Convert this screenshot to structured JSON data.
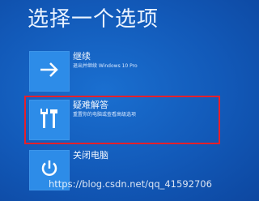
{
  "page": {
    "title": "选择一个选项"
  },
  "options": [
    {
      "title": "继续",
      "description": "退出并继续 Windows 10 Pro",
      "icon": "arrow-right-icon"
    },
    {
      "title": "疑难解答",
      "description": "重置你的电脑或查看高级选项",
      "icon": "tools-icon"
    },
    {
      "title": "关闭电脑",
      "description": "",
      "icon": "power-icon"
    }
  ],
  "highlight_color": "#e8202a",
  "tile_color": "#2d8ce8",
  "background_color": "#1259b8",
  "watermark": "https://blog.csdn.net/qq_41592706"
}
